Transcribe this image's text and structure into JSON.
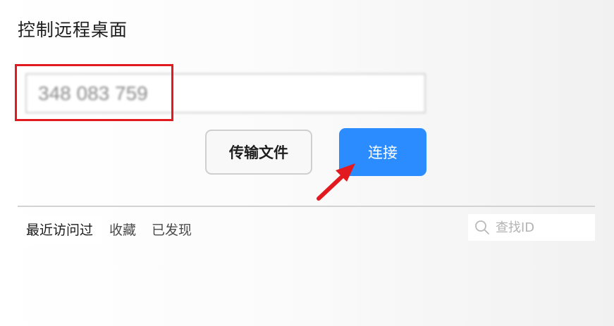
{
  "page": {
    "title": "控制远程桌面"
  },
  "remote_id": {
    "value": "348 083 759"
  },
  "buttons": {
    "transfer_label": "传输文件",
    "connect_label": "连接"
  },
  "tabs": [
    {
      "label": "最近访问过",
      "active": true
    },
    {
      "label": "收藏",
      "active": false
    },
    {
      "label": "已发现",
      "active": false
    }
  ],
  "search": {
    "placeholder": "查找ID"
  },
  "colors": {
    "accent": "#2b8cff",
    "highlight": "#e2191f",
    "arrow": "#e2191f"
  }
}
